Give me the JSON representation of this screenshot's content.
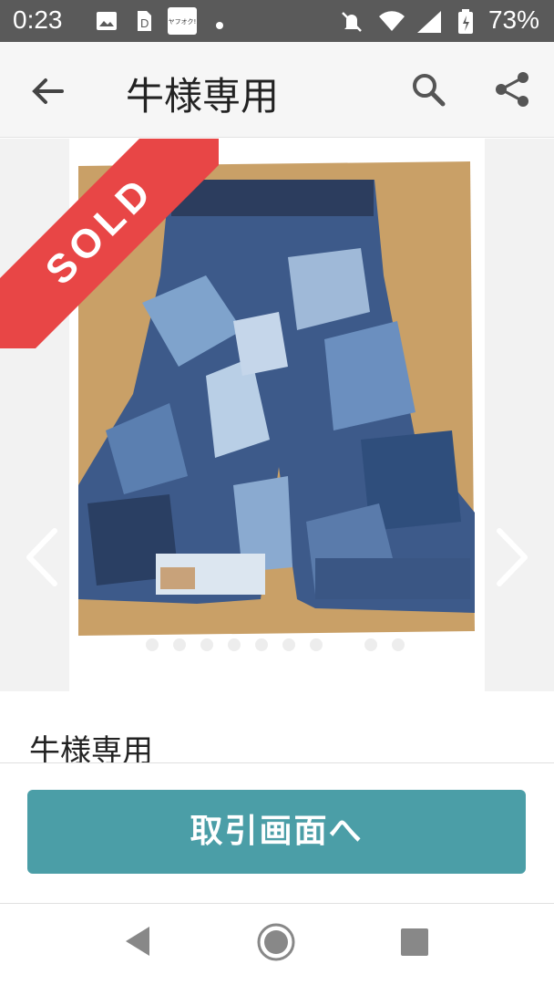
{
  "status_bar": {
    "time": "0:23",
    "battery_percent": "73%",
    "icons": [
      "image-icon",
      "sim-icon",
      "yahuoku-app-icon",
      "dot-icon",
      "silent-icon",
      "wifi-icon",
      "signal-icon",
      "battery-icon"
    ],
    "notification_badge_text": "ヤフオク!"
  },
  "app_bar": {
    "title": "牛様専用",
    "icons": [
      "back-arrow-icon",
      "search-icon",
      "share-icon"
    ]
  },
  "gallery": {
    "sold_label": "SOLD",
    "page_dots_count": 9,
    "accent_colors": {
      "sold": "#e84646",
      "button": "#4b9ea7"
    }
  },
  "item": {
    "name": "牛様専用"
  },
  "action": {
    "button_label": "取引画面へ"
  },
  "nav_bar": {
    "icons": [
      "nav-back-icon",
      "nav-home-icon",
      "nav-recent-icon"
    ]
  }
}
